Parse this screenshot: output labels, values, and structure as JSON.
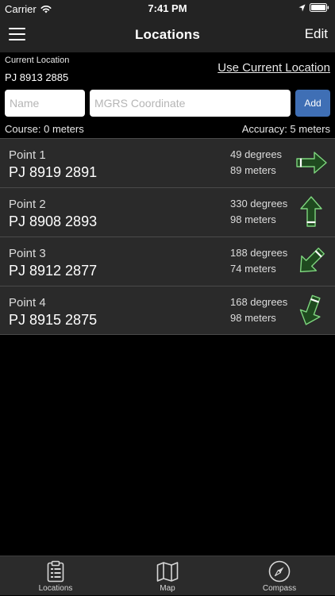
{
  "status_bar": {
    "carrier": "Carrier",
    "time": "7:41 PM"
  },
  "nav": {
    "title": "Locations",
    "edit_label": "Edit"
  },
  "current": {
    "label": "Current Location",
    "coordinate": "PJ 8913 2885",
    "use_current_label": "Use Current Location"
  },
  "inputs": {
    "name_placeholder": "Name",
    "name_value": "",
    "mgrs_placeholder": "MGRS Coordinate",
    "mgrs_value": "",
    "add_label": "Add"
  },
  "stats": {
    "course": "Course: 0 meters",
    "accuracy": "Accuracy: 5 meters"
  },
  "points": [
    {
      "name": "Point 1",
      "coordinate": "PJ 8919 2891",
      "degrees_text": "49 degrees",
      "distance_text": "89 meters",
      "arrow_heading": 90
    },
    {
      "name": "Point 2",
      "coordinate": "PJ 8908 2893",
      "degrees_text": "330 degrees",
      "distance_text": "98 meters",
      "arrow_heading": 0
    },
    {
      "name": "Point 3",
      "coordinate": "PJ 8912 2877",
      "degrees_text": "188 degrees",
      "distance_text": "74 meters",
      "arrow_heading": 225
    },
    {
      "name": "Point 4",
      "coordinate": "PJ 8915 2875",
      "degrees_text": "168 degrees",
      "distance_text": "98 meters",
      "arrow_heading": 200
    }
  ],
  "tabs": [
    {
      "label": "Locations",
      "icon": "clipboard-icon"
    },
    {
      "label": "Map",
      "icon": "map-icon"
    },
    {
      "label": "Compass",
      "icon": "compass-icon"
    }
  ],
  "colors": {
    "background": "#000000",
    "bar": "#232323",
    "row": "#2a2a2a",
    "add_button": "#3f6fb5",
    "arrow_fill": "#1f4a1f",
    "arrow_stroke": "#7ed67e"
  }
}
